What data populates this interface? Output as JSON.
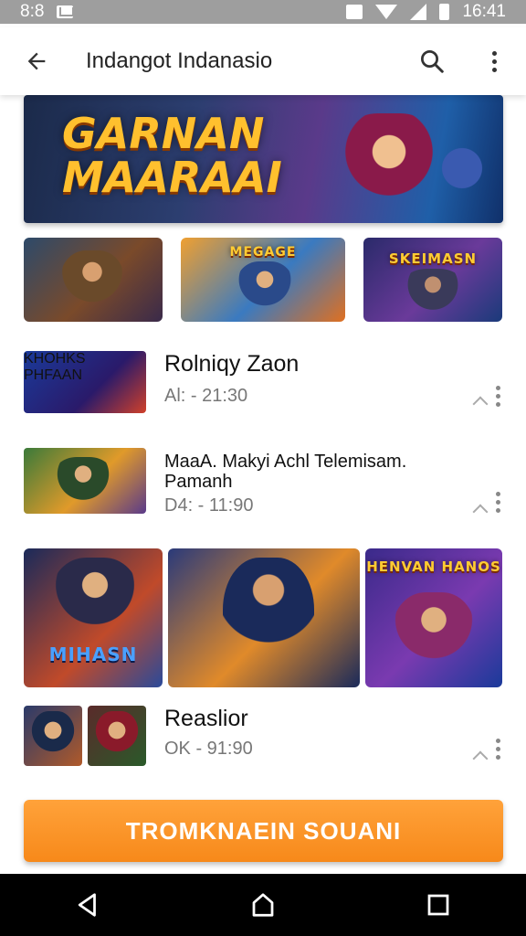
{
  "status_bar": {
    "time_left": "8:8",
    "time_right": "16:41"
  },
  "app_bar": {
    "title": "Indangot Indanasio",
    "back_icon": "arrow-left-icon",
    "search_icon": "search-icon",
    "more_icon": "more-vert-icon"
  },
  "hero": {
    "title_line1": "GARNAN",
    "title_line2": "MAARAAI"
  },
  "thumbnails": [
    {
      "label": ""
    },
    {
      "label": "MEGAGE"
    },
    {
      "label": "SKEIMASN"
    }
  ],
  "items": [
    {
      "title": "Rolniqy Zaon",
      "meta": "Al: - 21:30",
      "thumb_label": "KHOHKS PHFAAN"
    },
    {
      "title": "MaaA. Makyi Achl Telemisam. Pamanh",
      "meta": "D4: - 11:90",
      "thumb_label": ""
    },
    {
      "title": "Reaslior",
      "meta": "OK - 91:90",
      "thumb_label": ""
    }
  ],
  "gallery": [
    {
      "label": "MIHASN"
    },
    {
      "label": ""
    },
    {
      "label": "HENVAN HANOS"
    }
  ],
  "cta": {
    "label": "TROMKNAEIN SOUANI"
  },
  "colors": {
    "accent": "#f7891a",
    "app_bar": "#ffffff",
    "status_bar": "#9e9e9e",
    "nav_bar": "#000000"
  }
}
